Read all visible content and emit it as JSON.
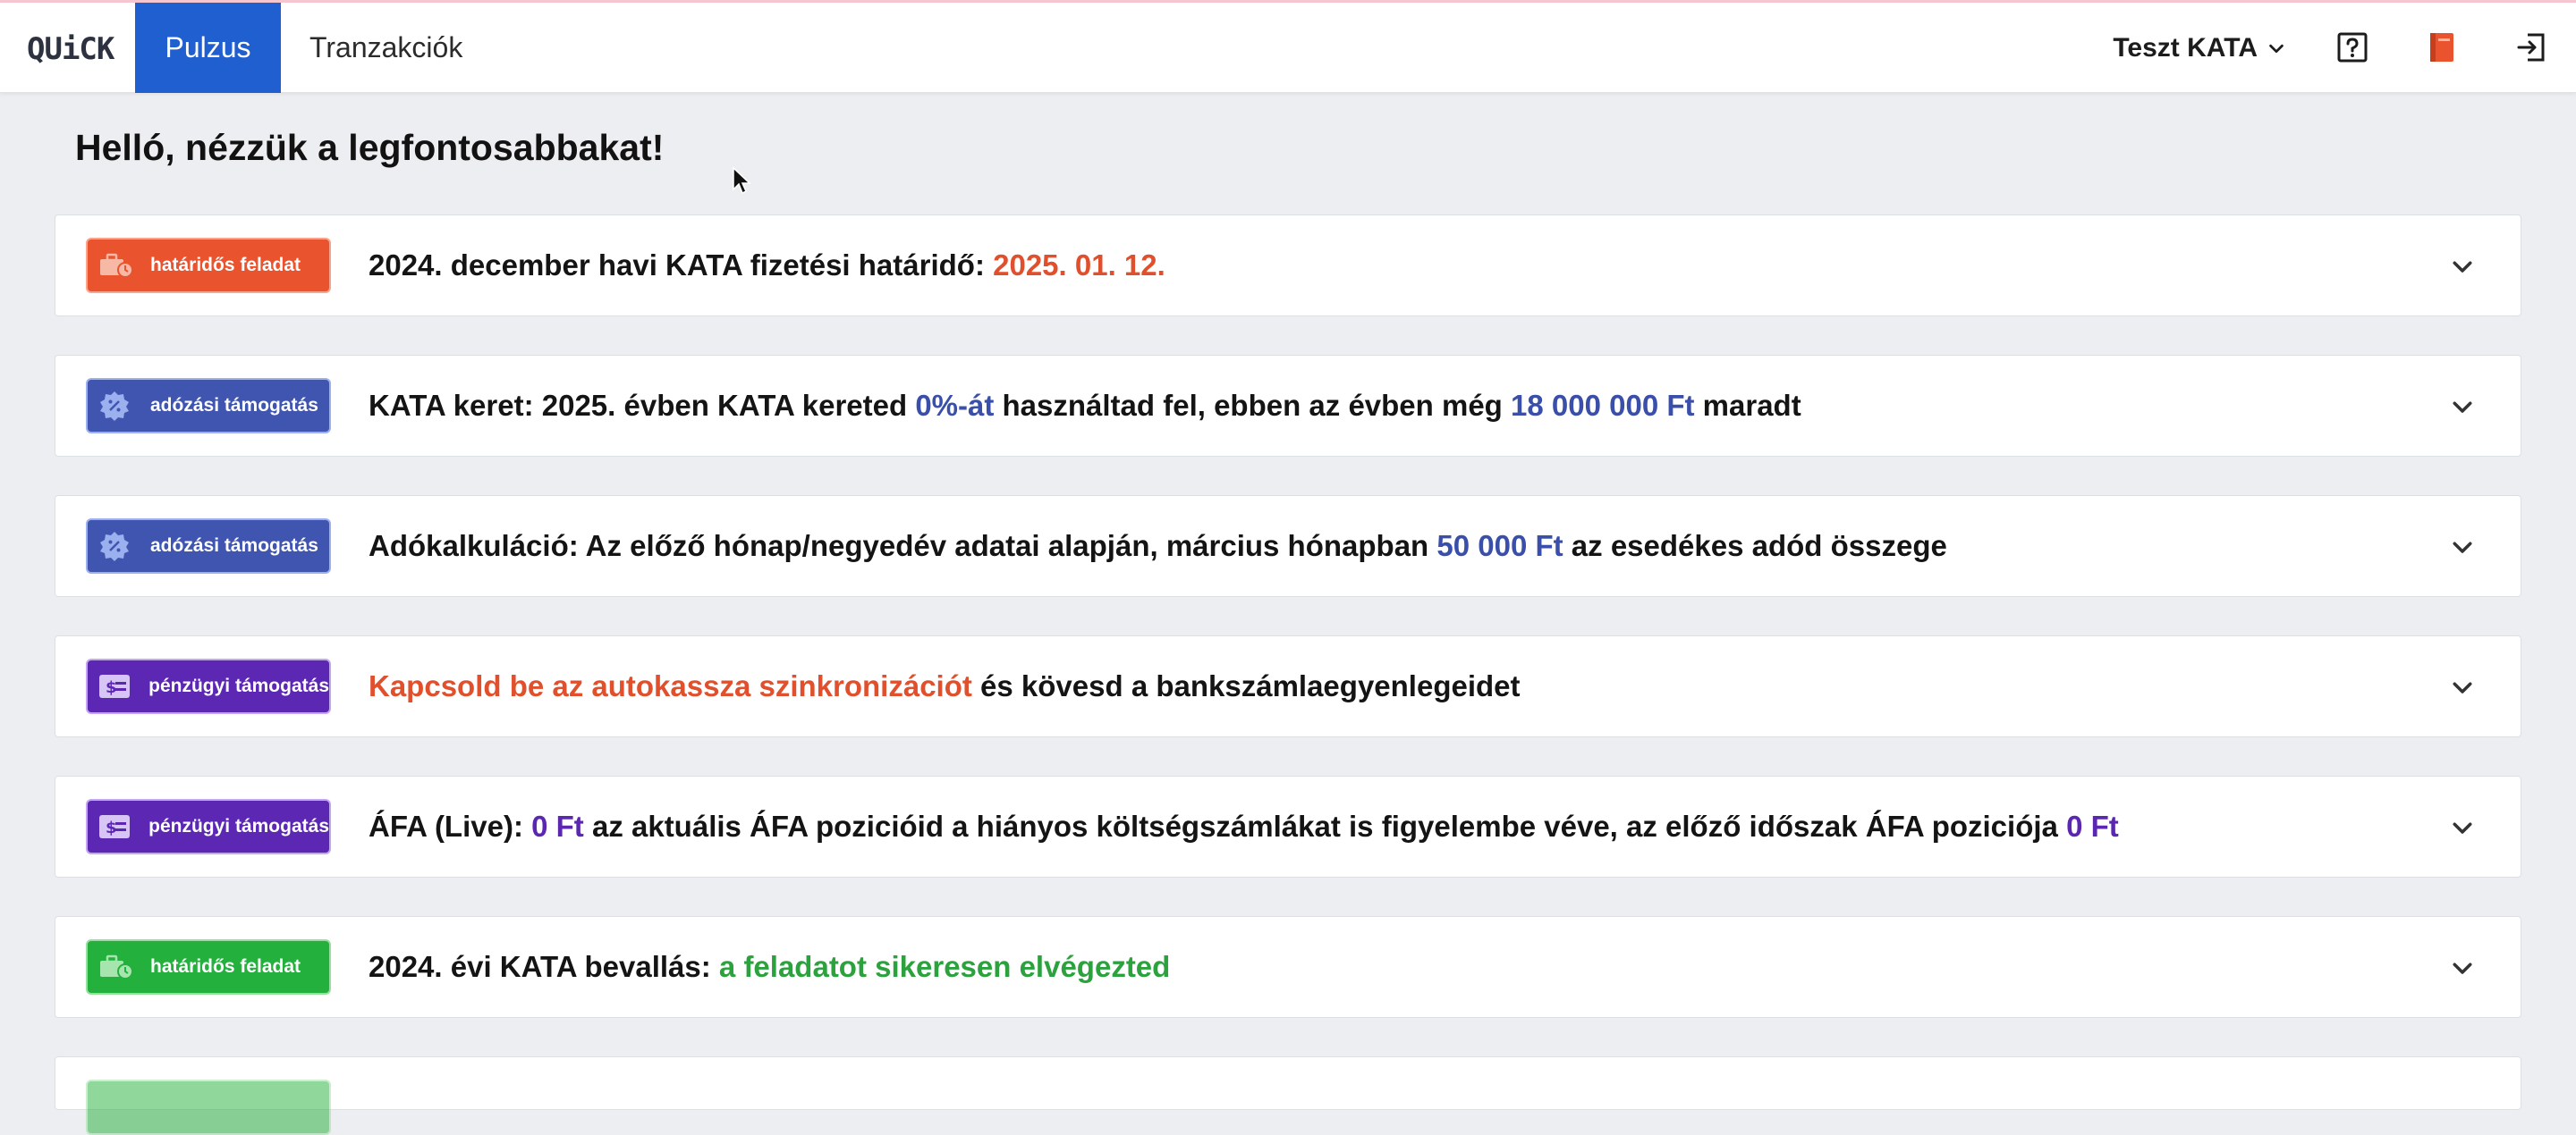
{
  "app": {
    "logo": "QUiCK"
  },
  "nav": {
    "tabs": [
      {
        "label": "Pulzus",
        "active": true
      },
      {
        "label": "Tranzakciók",
        "active": false
      }
    ]
  },
  "header": {
    "user_menu_label": "Teszt KATA",
    "icons": [
      "help-icon",
      "book-icon",
      "logout-icon"
    ]
  },
  "page": {
    "greeting": "Helló, nézzük a legfontosabbakat!"
  },
  "cards": [
    {
      "badge": "határidős feladat",
      "badge_color": "#e9532d",
      "parts": [
        "2024. december havi KATA fizetési határidő: ",
        "2025. 01. 12."
      ]
    },
    {
      "badge": "adózási támogatás",
      "badge_color": "#3f55b0",
      "parts": [
        "KATA keret: 2025. évben KATA kereted ",
        "0%-át",
        " használtad fel, ebben az évben még ",
        "18 000 000 Ft",
        " maradt"
      ]
    },
    {
      "badge": "adózási támogatás",
      "badge_color": "#3f55b0",
      "parts": [
        "Adókalkuláció: Az előző hónap/negyedév adatai alapján, március hónapban ",
        "50 000 Ft",
        " az esedékes adód összege"
      ]
    },
    {
      "badge": "pénzügyi támogatás",
      "badge_color": "#5c27b3",
      "parts": [
        "Kapcsold be az autokassza szinkronizációt",
        " és kövesd a bankszámlaegyenlegeidet"
      ]
    },
    {
      "badge": "pénzügyi támogatás",
      "badge_color": "#5c27b3",
      "parts": [
        "ÁFA (Live): ",
        "0 Ft",
        " az aktuális ÁFA pozicióid a hiányos költségszámlákat is figyelembe véve, az előző időszak ÁFA poziciója ",
        "0 Ft"
      ]
    },
    {
      "badge": "határidős feladat",
      "badge_color": "#24b03c",
      "parts": [
        "2024. évi KATA bevallás: ",
        "a feladatot sikeresen elvégezted"
      ]
    }
  ],
  "colors": {
    "accent": "#1f5fcf",
    "deadline": "#e9532d",
    "tax": "#3f55b0",
    "finance": "#5c27b3",
    "done": "#24b03c"
  }
}
